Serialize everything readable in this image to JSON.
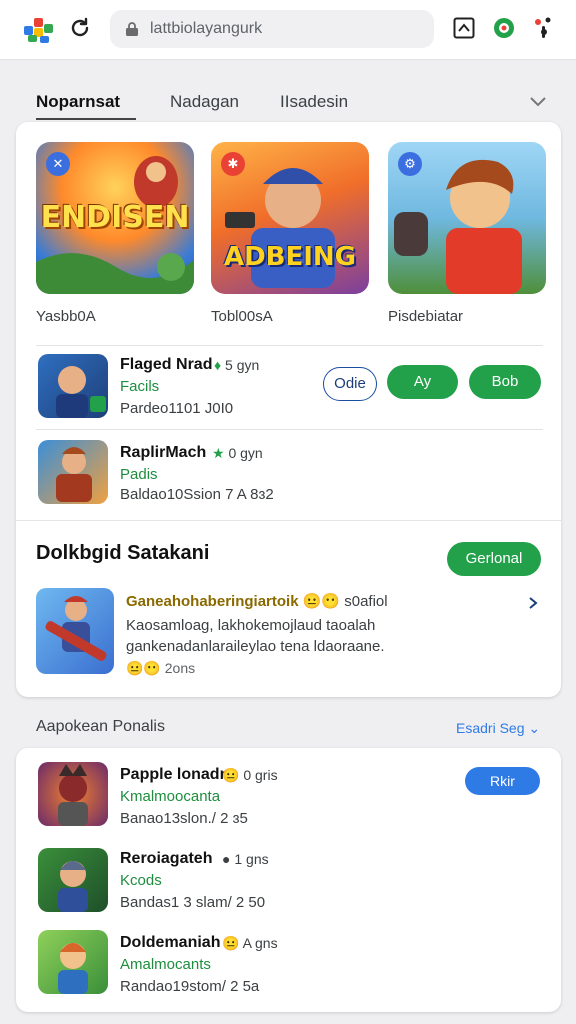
{
  "browser": {
    "url": "lattbiolayangurk",
    "icons": [
      "multicolor-logo-icon",
      "reload-icon",
      "lock-icon",
      "share-icon",
      "extension-icon",
      "menu-dots-icon"
    ]
  },
  "tabs": [
    {
      "label": "Noparnsat",
      "active": true
    },
    {
      "label": "Nadagan",
      "active": false
    },
    {
      "label": "IIsadesin",
      "active": false
    }
  ],
  "featured": [
    {
      "art_text": "ENDISEN",
      "caption": "Yasbb0A"
    },
    {
      "art_text": "ADBEING",
      "caption": "Tobl00sA"
    },
    {
      "art_text": "",
      "caption": "Pisdebiatar"
    }
  ],
  "apps": [
    {
      "title": "Flaged Nrad",
      "rating": "5 gyn",
      "sub": "Facils",
      "meta": "Pardeo1101 J0I0"
    },
    {
      "title": "RaplirMach",
      "rating": "0 gyn",
      "sub": "Padis",
      "meta": "Baldao10Ssion 7 A 8ɜ2"
    }
  ],
  "buttons": {
    "odie": "Odie",
    "ay": "Ay",
    "bob": "Bob"
  },
  "section": {
    "title": "Dolkbgid Satakani",
    "button": "Gerlonal"
  },
  "post": {
    "title": "Ganeahohaberingiartoik",
    "title_suffix": "s0afiol",
    "line1": "Kaosamloag, lakhokemojlaud taoalah",
    "line2": "gankenadanlaraileylao tena ldaoraane.",
    "footer": "2ons"
  },
  "list_header": {
    "title": "Aapokean Ponalis",
    "link": "Esadri Seg"
  },
  "list": [
    {
      "title": "Papple lonadn",
      "rating": "0 gris",
      "sub": "Kmalmoocanta",
      "meta": "Banao13slon./ 2 ɜ5",
      "button": "Rkir"
    },
    {
      "title": "Reroiagateh",
      "rating": "1 gns",
      "sub": "Kcods",
      "meta": "Bandas1 3 slam/ 2 50",
      "button": ""
    },
    {
      "title": "Doldemaniah",
      "rating": "A gns",
      "sub": "Amalmocants",
      "meta": "Randao19stom/ 2 5a",
      "button": ""
    }
  ],
  "colors": {
    "green": "#22a04a",
    "blue": "#2f7be6",
    "link_blue": "#2f7be6"
  }
}
